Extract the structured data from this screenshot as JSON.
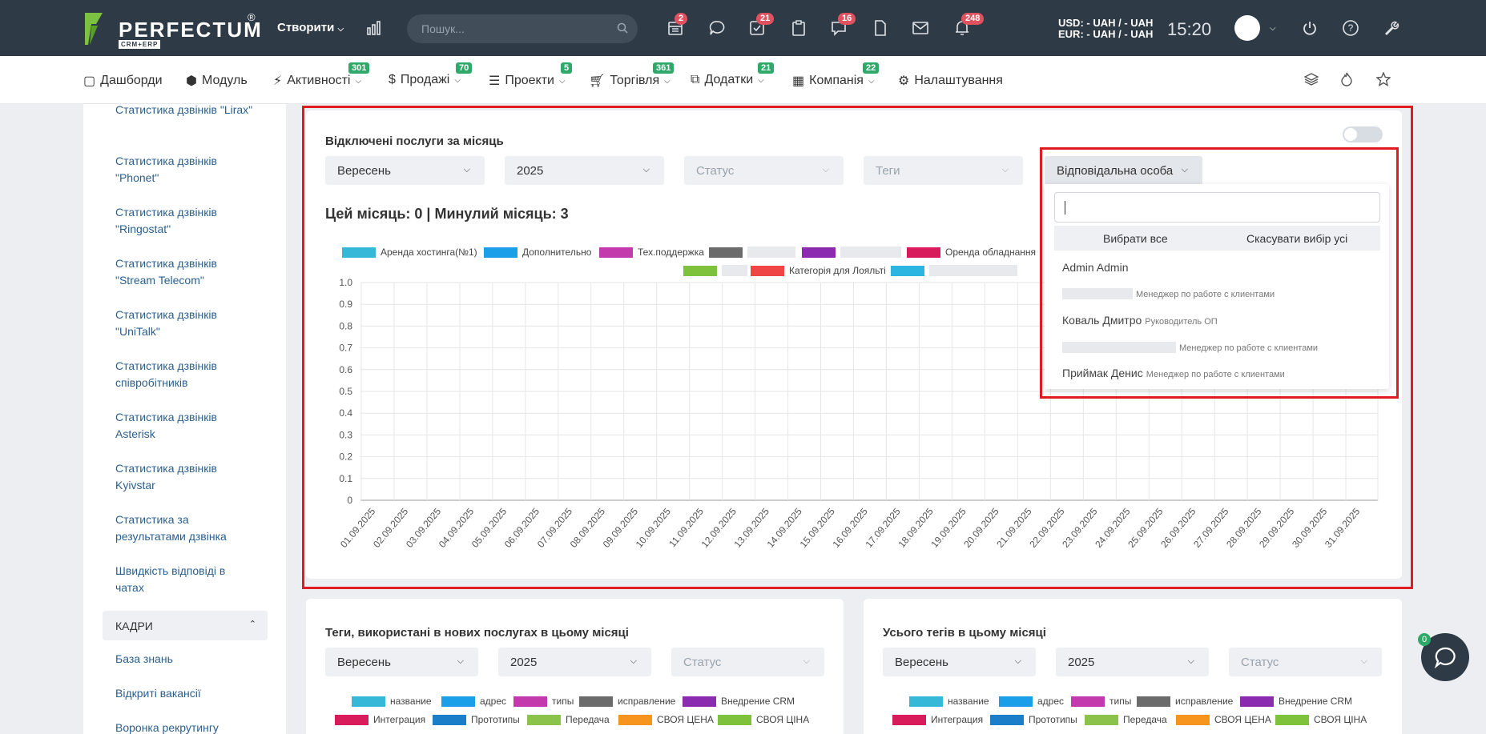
{
  "header": {
    "brand": "PERFECTUM",
    "brand_reg": "®",
    "brand_sub": "CRM+ERP",
    "create_label": "Створити",
    "search_placeholder": "Пошук...",
    "badges": {
      "calendar": "2",
      "tasks": "21",
      "messages": "16",
      "notifications": "248"
    },
    "usd": "USD: - UAH / - UAH",
    "eur": "EUR: - UAH / - UAH",
    "time": "15:20"
  },
  "nav": {
    "items": [
      {
        "label": "Дашборди"
      },
      {
        "label": "Модуль"
      },
      {
        "label": "Активності",
        "badge": "301"
      },
      {
        "label": "Продажі",
        "badge": "70"
      },
      {
        "label": "Проекти",
        "badge": "5"
      },
      {
        "label": "Торгівля",
        "badge": "361"
      },
      {
        "label": "Додатки",
        "badge": "21"
      },
      {
        "label": "Компанія",
        "badge": "22"
      },
      {
        "label": "Налаштування"
      }
    ]
  },
  "sidebar": {
    "items": [
      "Статистика дзвінків \"Lirax\"",
      "Статистика дзвінків \"Phonet\"",
      "Статистика дзвінків \"Ringostat\"",
      "Статистика дзвінків \"Stream Telecom\"",
      "Статистика дзвінків \"UniTalk\"",
      "Статистика дзвінків співробітників",
      "Статистика дзвінків Asterisk",
      "Статистика дзвінків Kyivstar",
      "Статистика за результатами дзвінка",
      "Швидкість відповіді в чатах"
    ],
    "section": "КАДРИ",
    "section_items": [
      "База знань",
      "Відкриті вакансії",
      "Воронка рекрутингу"
    ]
  },
  "main_card": {
    "title": "Відключені послуги за місяць",
    "filters": {
      "month": "Вересень",
      "year": "2025",
      "status": "Статус",
      "tags": "Теги",
      "responsible": "Відповідальна особа"
    },
    "stats": "Цей місяць: 0 | Минулий місяць: 3",
    "legend": [
      {
        "label": "Аренда хостинга(№1)",
        "color": "#36b9d8"
      },
      {
        "label": "Дополнительно",
        "color": "#1a9fe8"
      },
      {
        "label": "Тех.поддержка",
        "color": "#c23aac"
      },
      {
        "label": "",
        "color": "#6b6b6b"
      },
      {
        "label": "",
        "color": "#8a2bb0"
      },
      {
        "label": "Оренда обладнання",
        "color": "#d81b5a"
      },
      {
        "label": "",
        "color": "#7dc23a"
      },
      {
        "label": "Категорія для Лояльті",
        "color": "#f04545"
      },
      {
        "label": "",
        "color": "#2cb5e0"
      }
    ]
  },
  "chart_data": {
    "type": "line",
    "x": [
      "01.09.2025",
      "02.09.2025",
      "03.09.2025",
      "04.09.2025",
      "05.09.2025",
      "06.09.2025",
      "07.09.2025",
      "08.09.2025",
      "09.09.2025",
      "10.09.2025",
      "11.09.2025",
      "12.09.2025",
      "13.09.2025",
      "14.09.2025",
      "15.09.2025",
      "16.09.2025",
      "17.09.2025",
      "18.09.2025",
      "19.09.2025",
      "20.09.2025",
      "21.09.2025",
      "22.09.2025",
      "23.09.2025",
      "24.09.2025",
      "25.09.2025",
      "26.09.2025",
      "27.09.2025",
      "28.09.2025",
      "29.09.2025",
      "30.09.2025",
      "31.09.2025"
    ],
    "yticks": [
      "1.0",
      "0.9",
      "0.8",
      "0.7",
      "0.6",
      "0.5",
      "0.4",
      "0.3",
      "0.2",
      "0.1",
      "0"
    ],
    "ylim": [
      0,
      1
    ],
    "grid": true,
    "series": []
  },
  "dropdown": {
    "select_all": "Вибрати все",
    "deselect_all": "Скасувати вибір усі",
    "users": [
      {
        "name": "Admin Admin",
        "role": ""
      },
      {
        "name": "",
        "role": "Менеджер по работе с клиентами"
      },
      {
        "name": "Коваль Дмитро",
        "role": "Руководитель ОП"
      },
      {
        "name": "",
        "role": "Менеджер по работе с клиентами"
      },
      {
        "name": "Приймак Денис",
        "role": "Менеджер по работе с клиентами"
      }
    ]
  },
  "card2": {
    "title": "Теги, використані в нових послугах в цьому місяці",
    "filters": {
      "month": "Вересень",
      "year": "2025",
      "status": "Статус"
    },
    "legend_row1": [
      {
        "label": "название",
        "color": "#36b9d8"
      },
      {
        "label": "адрес",
        "color": "#1a9fe8"
      },
      {
        "label": "типы",
        "color": "#c23aac"
      },
      {
        "label": "исправление",
        "color": "#6b6b6b"
      },
      {
        "label": "Внедрение CRM",
        "color": "#8a2bb0"
      }
    ],
    "legend_row2": [
      {
        "label": "Интеграция",
        "color": "#d81b5a"
      },
      {
        "label": "Прототипы",
        "color": "#1a7fc8"
      },
      {
        "label": "Передача",
        "color": "#8bc34a"
      },
      {
        "label": "СВОЯ ЦЕНА",
        "color": "#f7941d"
      },
      {
        "label": "СВОЯ ЦІНА",
        "color": "#7dc23a"
      }
    ]
  },
  "card3": {
    "title": "Усього тегів в цьому місяці",
    "filters": {
      "month": "Вересень",
      "year": "2025",
      "status": "Статус"
    }
  },
  "chat": {
    "badge": "0"
  }
}
